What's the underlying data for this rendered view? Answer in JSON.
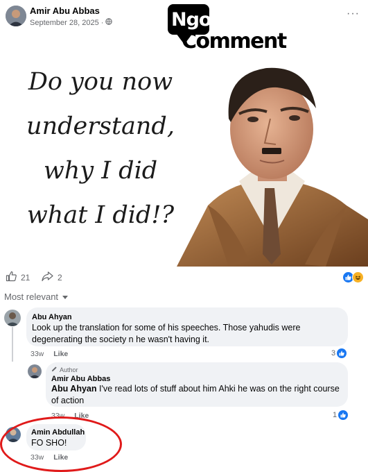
{
  "post": {
    "author": "Amir Abu Abbas",
    "date": "September 28, 2025",
    "separator": "·",
    "privacy_icon": "globe-icon",
    "more_icon": "more-horizontal-icon",
    "more_label": "···"
  },
  "watermark": {
    "line1": "Ngo",
    "line2": "Comment"
  },
  "image": {
    "lines": [
      "Do you now",
      "understand,",
      "why I did",
      "what I did!?"
    ]
  },
  "reactions": {
    "like_count": "21",
    "share_count": "2",
    "like_icon": "thumbs-up-icon",
    "share_icon": "share-arrow-icon",
    "summary_icons": [
      "like-reaction-icon",
      "haha-reaction-icon"
    ]
  },
  "sort": {
    "label": "Most relevant",
    "icon": "caret-down-icon"
  },
  "comments": [
    {
      "name": "Abu Ahyan",
      "text": "Look up the translation for some of his speeches. Those yahudis were degenerating the society n he wasn't having it.",
      "time": "33w",
      "like": "Like",
      "likes": "3"
    },
    {
      "author_badge": "Author",
      "name": "Amir Abu Abbas",
      "mention": "Abu Ahyan",
      "text": " I've read lots of stuff about him Ahki he was on the right course of action",
      "time": "33w",
      "like": "Like",
      "likes": "1"
    },
    {
      "name": "Amin Abdullah",
      "text": "FO SHO!",
      "time": "33w",
      "like": "Like"
    }
  ],
  "colors": {
    "accent": "#1877f2",
    "annotation": "#e01a1a",
    "bubble": "#f0f2f5"
  }
}
